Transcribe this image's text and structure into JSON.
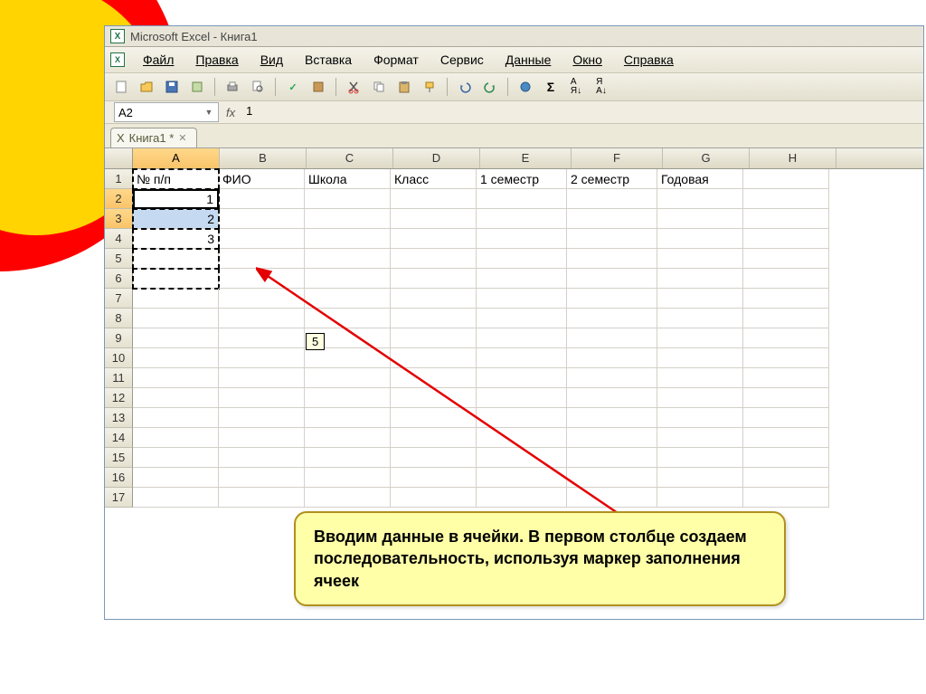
{
  "window": {
    "title": "Microsoft Excel - Книга1"
  },
  "menu": {
    "file": "Файл",
    "edit": "Правка",
    "view": "Вид",
    "insert": "Вставка",
    "format": "Формат",
    "tools": "Сервис",
    "data": "Данные",
    "window": "Окно",
    "help": "Справка"
  },
  "name_box": "A2",
  "fx_label": "fx",
  "formula": "1",
  "doc_tab": {
    "label": "Книга1 *"
  },
  "columns": [
    "A",
    "B",
    "C",
    "D",
    "E",
    "F",
    "G",
    "H"
  ],
  "rows": [
    "1",
    "2",
    "3",
    "4",
    "5",
    "6",
    "7",
    "8",
    "9",
    "10",
    "11",
    "12",
    "13",
    "14",
    "15",
    "16",
    "17"
  ],
  "headers": {
    "c0": "№ п/п",
    "c1": "ФИО",
    "c2": "Школа",
    "c3": "Класс",
    "c4": "1 семестр",
    "c5": "2 семестр",
    "c6": "Годовая"
  },
  "values": {
    "a2": "1",
    "a3": "2",
    "a4": "3"
  },
  "fill_tip": "5",
  "selection": {
    "active_cell": "A2",
    "marching_range": "A1:A6",
    "highlight_range": "A2:A3"
  },
  "callout": "Вводим данные в ячейки. В первом столбце создаем последовательность, используя маркер заполнения ячеек"
}
